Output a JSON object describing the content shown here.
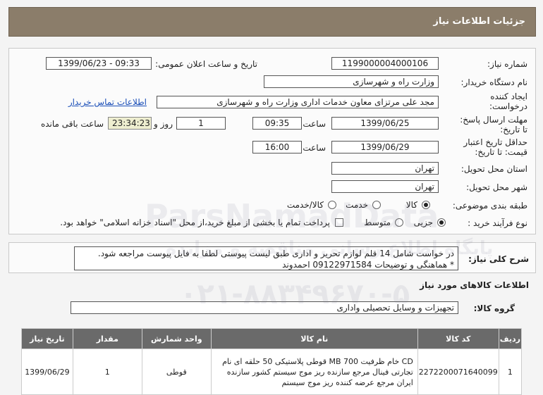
{
  "header": {
    "title": "جزئیات اطلاعات نیاز"
  },
  "fields": {
    "need_number_label": "شماره نیاز:",
    "need_number": "1199000004000106",
    "announce_label": "تاریخ و ساعت اعلان عمومی:",
    "announce_value": "1399/06/23 - 09:33",
    "buyer_org_label": "نام دستگاه خریدار:",
    "buyer_org": "وزارت راه و شهرسازی",
    "creator_label_1": "ایجاد کننده",
    "creator_label_2": "درخواست:",
    "creator": "مجد علی  مرتزای معاون خدمات اداری وزارت راه و شهرسازی",
    "contact_link": "اطلاعات تماس خریدار",
    "deadline_label_1": "مهلت ارسال پاسخ:",
    "deadline_label_2": "تا تاریخ:",
    "deadline_date": "1399/06/25",
    "time_label": "ساعت",
    "deadline_time": "09:35",
    "days_value": "1",
    "days_label": "روز و",
    "remaining_timer": "23:34:23",
    "remaining_label": "ساعت باقی مانده",
    "validity_label_1": "حداقل تاریخ اعتبار",
    "validity_label_2": "قیمت: تا تاریخ:",
    "validity_date": "1399/06/29",
    "validity_time_label": "ساعت",
    "validity_time": "16:00",
    "province_label": "استان محل تحویل:",
    "province": "تهران",
    "city_label": "شهر محل تحویل:",
    "city": "تهران",
    "category_label": "طبقه بندی موضوعی:",
    "category_options": [
      "کالا",
      "خدمت",
      "کالا/خدمت"
    ],
    "purchase_type_label": "نوع فرآیند خرید :",
    "purchase_options": [
      "جزیی",
      "متوسط"
    ],
    "payment_note": "پرداخت تمام یا بخشی از مبلغ خرید،از محل \"اسناد خزانه اسلامی\" خواهد بود."
  },
  "description": {
    "label": "شرح کلی نیاز:",
    "line1": "در خواست شامل 14 قلم لوازم تحریر و اداری طبق لیست پیوستی لطفا به فایل پیوست مراجعه شود.",
    "line2": "* هماهنگی و توضیحات 09122971584 احمدوند"
  },
  "goods_section": {
    "title": "اطلاعات کالاهای مورد نیاز",
    "group_label": "گروه کالا:",
    "group_value": "تجهیزات و وسایل تحصیلی واداری"
  },
  "table": {
    "headers": [
      "ردیف",
      "کد کالا",
      "نام کالا",
      "واحد شمارش",
      "مقدار",
      "تاریخ نیاز"
    ],
    "rows": [
      {
        "row": "1",
        "code": "2272200071640099",
        "name_l1": "CD خام ظرفیت MB 700 قوطی پلاستیکی 50 حلقه ای نام",
        "name_l2": "تجارتی فینال مرجع سازنده ریز موج سیستم کشور سازنده",
        "name_l3": "ایران مرجع عرضه کننده ریز موج سیستم",
        "unit": "قوطی",
        "qty": "1",
        "date": "1399/06/29"
      }
    ]
  },
  "watermark": {
    "line1": "ParsNamadData",
    "line2": "پایگاه اطلاع رسانی مناقصه و مزایده",
    "line3": "۰۲۱-۸۸۳۴۹۶۷۰-۵"
  }
}
